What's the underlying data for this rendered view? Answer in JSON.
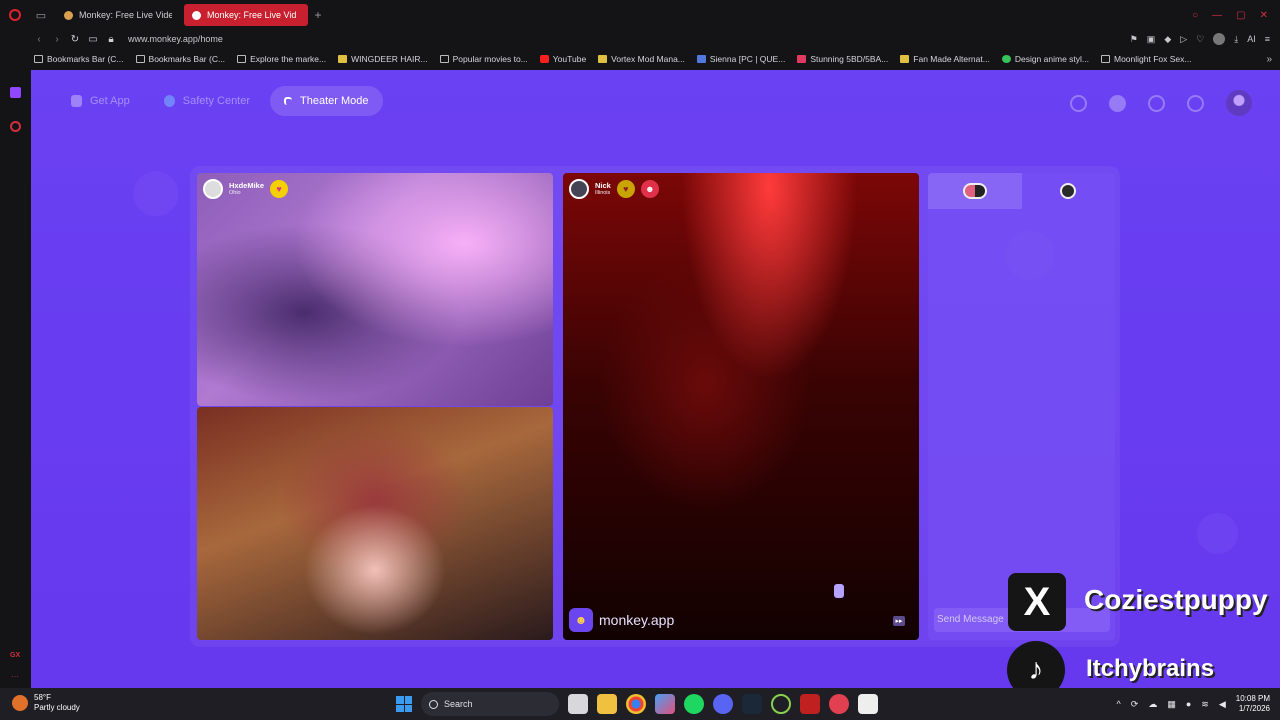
{
  "browser": {
    "tabs": [
      {
        "label": "Monkey: Free Live Video C",
        "active": false
      },
      {
        "label": "Monkey: Free Live Vid",
        "active": true
      }
    ],
    "url": "www.monkey.app/home",
    "bookmarks": [
      {
        "label": "Bookmarks Bar (C...",
        "icon": "folder-icon"
      },
      {
        "label": "Bookmarks Bar (C...",
        "icon": "folder-icon"
      },
      {
        "label": "Explore the marke...",
        "icon": "page-icon"
      },
      {
        "label": "WINGDEER HAIR...",
        "icon": "page-icon"
      },
      {
        "label": "Popular movies to...",
        "icon": "page-icon"
      },
      {
        "label": "YouTube",
        "icon": "youtube-icon"
      },
      {
        "label": "Vortex Mod Mana...",
        "icon": "page-icon"
      },
      {
        "label": "Sienna [PC | QUE...",
        "icon": "page-icon"
      },
      {
        "label": "Stunning 5BD/5BA...",
        "icon": "page-icon"
      },
      {
        "label": "Fan Made Alternat...",
        "icon": "page-icon"
      },
      {
        "label": "Design anime styl...",
        "icon": "page-icon"
      },
      {
        "label": "Moonlight Fox Sex...",
        "icon": "page-icon"
      }
    ],
    "ai_label": "AI"
  },
  "sidebar": {
    "gx_label": "GX",
    "more": "···"
  },
  "monkey": {
    "nav": {
      "get_app": "Get App",
      "safety_center": "Safety Center",
      "theater_mode": "Theater Mode"
    },
    "peers": [
      {
        "name": "HxdeMike",
        "location": "Ohio"
      },
      {
        "name": "Nick",
        "location": "Illinois"
      }
    ],
    "watermark": "monkey.app",
    "chat_placeholder": "Send Message"
  },
  "overlays": {
    "x_handle": "Coziestpuppy",
    "tiktok_handle": "Itchybrains"
  },
  "taskbar": {
    "weather_temp": "58°F",
    "weather_desc": "Partly cloudy",
    "search_label": "Search",
    "time": "10:08 PM",
    "date": "1/7/2026"
  },
  "colors": {
    "page_bg": "#6a3ff2",
    "accent_red": "#c8202e"
  }
}
